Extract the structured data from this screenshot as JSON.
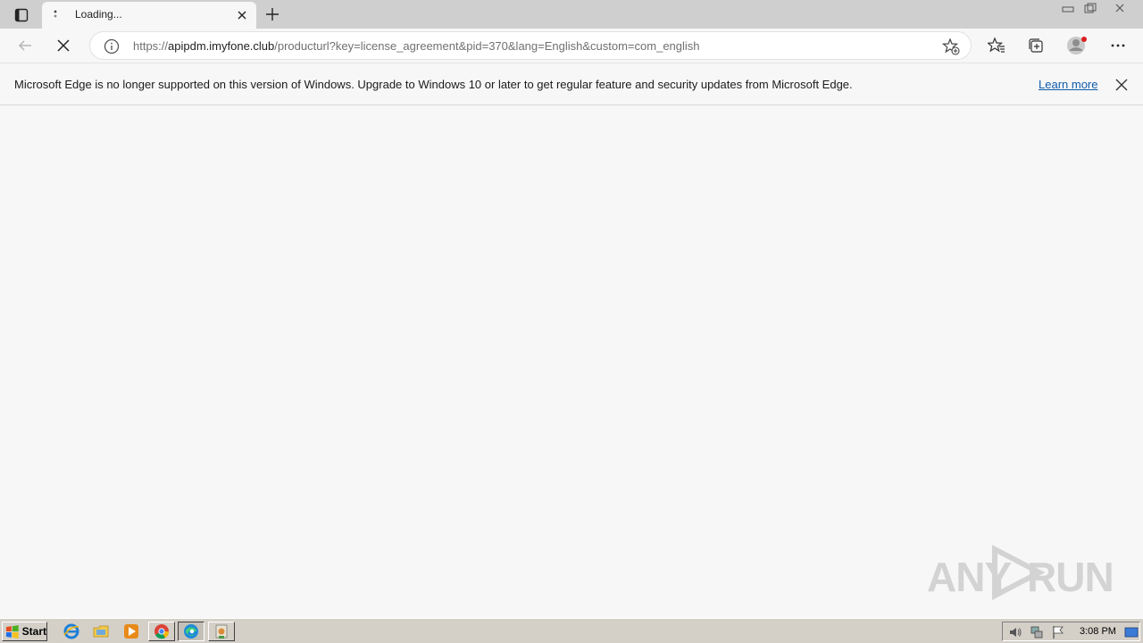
{
  "browser": {
    "tab": {
      "title": "Loading...",
      "loading": true
    },
    "new_tab_symbol": "+",
    "address": {
      "scheme": "https://",
      "host": "apipdm.imyfone.club",
      "path": "/producturl?key=license_agreement&pid=370&lang=English&custom=com_english"
    }
  },
  "infobar": {
    "message": "Microsoft Edge is no longer supported on this version of Windows. Upgrade to Windows 10 or later to get regular feature and security updates from Microsoft Edge.",
    "link": "Learn more"
  },
  "watermark": {
    "left": "ANY",
    "right": "RUN"
  },
  "taskbar": {
    "start_label": "Start",
    "clock": "3:08 PM"
  },
  "colors": {
    "accent_link": "#0f5cab",
    "page_bg": "#f7f7f7",
    "tab_strip": "#cfcfcf",
    "taskbar": "#d4d0c8"
  },
  "icons": [
    "tab-actions-icon",
    "loading-spinner-icon",
    "close-icon",
    "plus-icon",
    "back-arrow-icon",
    "stop-icon",
    "info-icon",
    "add-favorite-icon",
    "favorites-icon",
    "collections-icon",
    "profile-avatar",
    "more-menu-icon",
    "ie-icon",
    "explorer-folder-icon",
    "media-player-icon",
    "chrome-icon",
    "edge-icon",
    "app-icon",
    "volume-icon",
    "network-icon",
    "flag-icon",
    "show-desktop-icon"
  ]
}
